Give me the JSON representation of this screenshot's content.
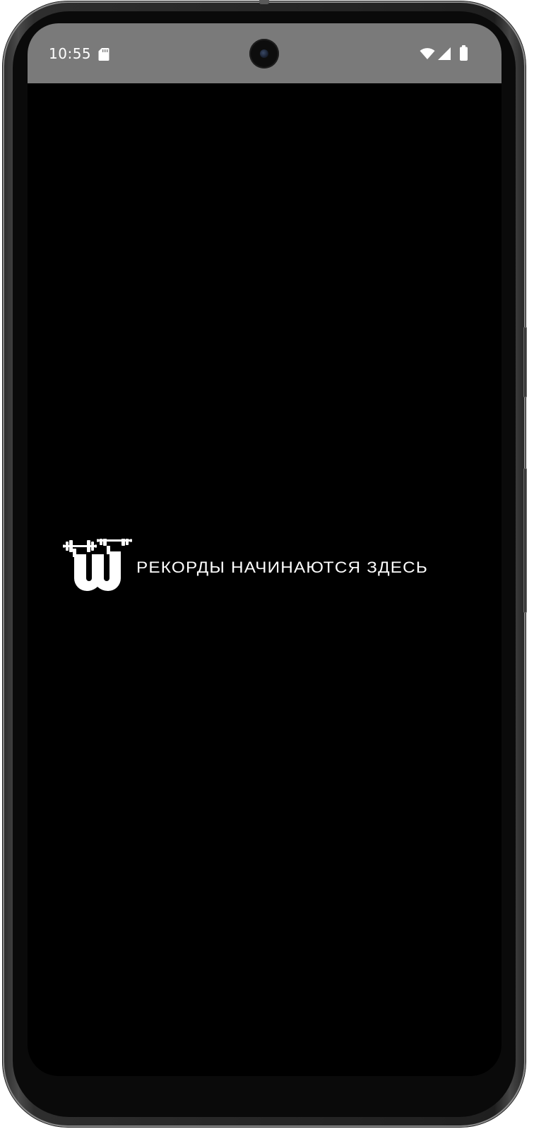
{
  "status_bar": {
    "time": "10:55",
    "icons": [
      "sd-card-icon",
      "wifi-icon",
      "cellular-signal-icon",
      "battery-icon"
    ]
  },
  "splash": {
    "logo": "dumbbell-w-logo",
    "tagline": "РЕКОРДЫ НАЧИНАЮТСЯ ЗДЕСЬ"
  },
  "colors": {
    "status_bar_bg": "#7a7a7a",
    "screen_bg": "#000000",
    "text": "#ffffff"
  }
}
